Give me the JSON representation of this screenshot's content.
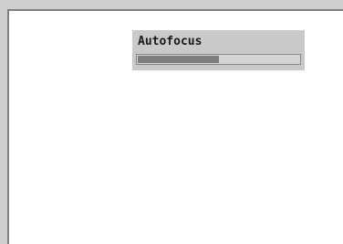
{
  "osd": {
    "title": "Autofocus",
    "progress": 0.5
  },
  "colors": {
    "background": "#cfcfcf",
    "viewport": "#ffffff",
    "panel": "#c9c9c9",
    "progress_fill": "#7e7e7e"
  }
}
